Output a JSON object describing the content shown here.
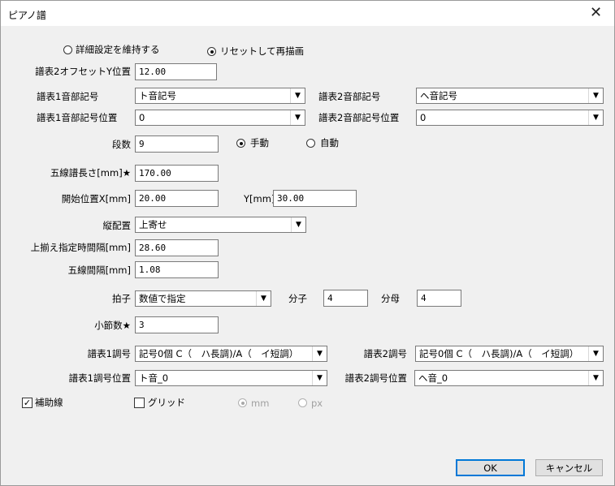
{
  "title": "ピアノ譜",
  "close_glyph": "✕",
  "radio_keep": "詳細設定を維持する",
  "radio_reset": "リセットして再描画",
  "offset_label": "譜表2オフセットY位置",
  "offset_value": "12.00",
  "clef1_label": "譜表1音部記号",
  "clef1_value": "ト音記号",
  "clef2_label": "譜表2音部記号",
  "clef2_value": "ヘ音記号",
  "clef1pos_label": "譜表1音部記号位置",
  "clef1pos_value": "0",
  "clef2pos_label": "譜表2音部記号位置",
  "clef2pos_value": "0",
  "rows_label": "段数",
  "rows_value": "9",
  "manual_label": "手動",
  "auto_label": "自動",
  "length_label": "五線譜長さ[mm]★",
  "length_value": "170.00",
  "startx_label": "開始位置X[mm]",
  "startx_value": "20.00",
  "y_label": "Y[mm]",
  "y_value": "30.00",
  "valign_label": "縦配置",
  "valign_value": "上寄せ",
  "spacing_top_label": "上揃え指定時間隔[mm]",
  "spacing_top_value": "28.60",
  "staff_spacing_label": "五線間隔[mm]",
  "staff_spacing_value": "1.08",
  "time_label": "拍子",
  "time_value": "数値で指定",
  "numerator_label": "分子",
  "numerator_value": "4",
  "denominator_label": "分母",
  "denominator_value": "4",
  "measures_label": "小節数★",
  "measures_value": "3",
  "key1_label": "譜表1調号",
  "key1_value": "記号0個 C（　ハ長調)/A（　イ短調）",
  "key2_label": "譜表2調号",
  "key2_value": "記号0個 C（　ハ長調)/A（　イ短調）",
  "key1pos_label": "譜表1調号位置",
  "key1pos_value": "ト音_0",
  "key2pos_label": "譜表2調号位置",
  "key2pos_value": "ヘ音_0",
  "guides_label": "補助線",
  "grid_label": "グリッド",
  "mm_label": "mm",
  "px_label": "px",
  "ok_label": "OK",
  "cancel_label": "キャンセル",
  "colors": {
    "accent": "#0078d7",
    "dialog_bg": "#f0f0f0",
    "disabled_text": "#a0a0a0"
  }
}
